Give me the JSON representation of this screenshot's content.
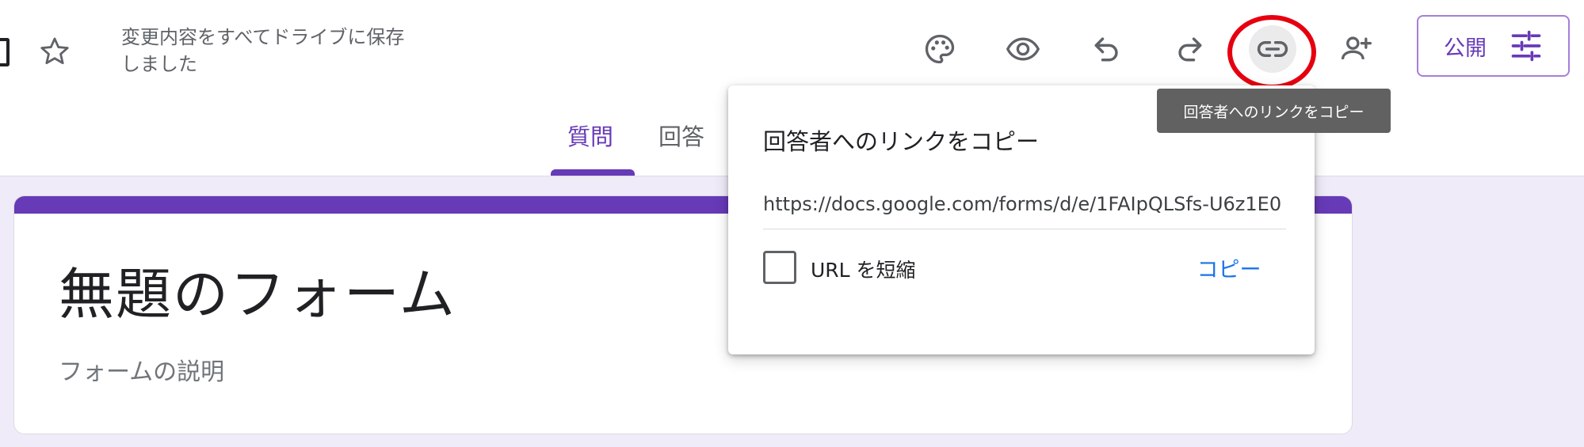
{
  "header": {
    "save_status": "変更内容をすべてドライブに保存しました",
    "publish_label": "公開",
    "icons": [
      "palette-icon",
      "preview-eye-icon",
      "undo-icon",
      "redo-icon",
      "link-icon",
      "add-collaborator-icon",
      "tune-icon"
    ]
  },
  "tabs": [
    {
      "label": "質問",
      "active": true
    },
    {
      "label": "回答",
      "active": false
    }
  ],
  "form": {
    "title": "無題のフォーム",
    "description_placeholder": "フォームの説明"
  },
  "link_popup": {
    "title": "回答者へのリンクをコピー",
    "url": "https://docs.google.com/forms/d/e/1FAIpQLSfs-U6z1E0",
    "shorten_label": "URL を短縮",
    "shorten_checked": false,
    "copy_label": "コピー"
  },
  "tooltip": {
    "text": "回答者へのリンクをコピー"
  },
  "colors": {
    "accent": "#673ab7",
    "link_blue": "#1a73e8",
    "callout_red": "#e6000f",
    "canvas_bg": "#f0ebf8",
    "tooltip_bg": "#616161"
  }
}
